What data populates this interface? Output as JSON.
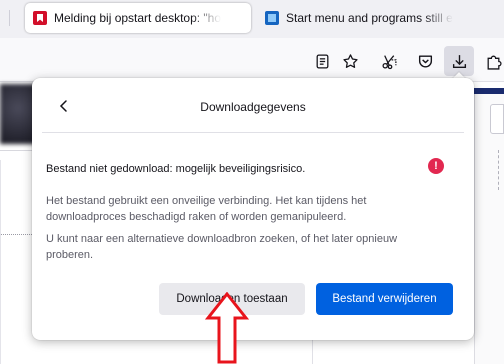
{
  "tabs": [
    {
      "title": "Melding bij opstart desktop: \"ho",
      "favicon": "red-bookmark-favicon",
      "active": true
    },
    {
      "title": "Start menu and programs still e",
      "favicon": "blue-favicon",
      "active": false
    }
  ],
  "toolbar": {
    "icons": [
      "reader-view-icon",
      "bookmark-star-icon",
      "screenshot-icon",
      "pocket-icon",
      "download-icon",
      "extensions-icon"
    ]
  },
  "downloads_panel": {
    "title": "Downloadgegevens",
    "back_icon": "chevron-left-icon",
    "warning_title": "Bestand niet gedownload: mogelijk beveiligingsrisico.",
    "warning_icon": "alert-circle-icon",
    "warning_icon_glyph": "!",
    "paragraph1": "Het bestand gebruikt een onveilige verbinding. Het kan tijdens het downloadproces beschadigd raken of worden gemanipuleerd.",
    "paragraph2": "U kunt naar een alternatieve downloadbron zoeken, of het later opnieuw proberen.",
    "allow_button": "Downloaden toestaan",
    "delete_button": "Bestand verwijderen"
  },
  "annotation": {
    "icon": "up-arrow-annotation",
    "color": "#e8141c"
  },
  "colors": {
    "accent": "#0061e0",
    "warning": "#e22850"
  }
}
